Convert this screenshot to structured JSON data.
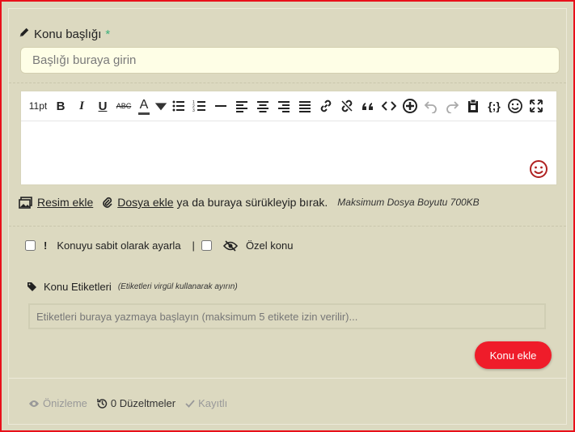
{
  "form": {
    "title_label": "Konu başlığı",
    "required_mark": "*",
    "title_placeholder": "Başlığı buraya girin"
  },
  "toolbar": {
    "font_size": "11pt",
    "bold": "B",
    "italic": "I",
    "underline": "U",
    "strike": "ABC",
    "font_color": "A"
  },
  "attach": {
    "image_link": "Resim ekle",
    "file_link": "Dosya ekle",
    "drag_text": "ya da buraya sürükleyip bırak.",
    "max_size": "Maksimum Dosya Boyutu 700KB"
  },
  "options": {
    "sticky_label": "Konuyu sabit olarak ayarla",
    "separator": "|",
    "private_label": "Özel konu"
  },
  "tags": {
    "label": "Konu Etiketleri",
    "hint": "(Etiketleri virgül kullanarak ayırın)",
    "placeholder": "Etiketleri buraya yazmaya başlayın (maksimum 5 etikete izin verilir)..."
  },
  "submit_label": "Konu ekle",
  "footer": {
    "preview": "Önizleme",
    "revisions": "0 Düzeltmeler",
    "saved": "Kayıtlı"
  },
  "colors": {
    "accent": "#ef1c2a",
    "background": "#dcd9c0",
    "required": "#3ab07a"
  },
  "icons": [
    "pencil-icon",
    "image-icon",
    "paperclip-icon",
    "exclamation-icon",
    "eye-slash-icon",
    "tag-icon",
    "eye-icon",
    "history-icon",
    "check-icon",
    "smile-icon"
  ]
}
